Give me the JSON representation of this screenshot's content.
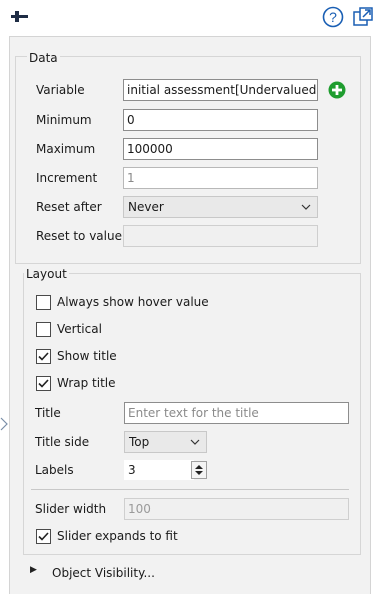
{
  "toolbar": {
    "tool_icon": "slider-tool-icon",
    "help_icon": "help-icon",
    "popout_icon": "popout-icon",
    "help_glyph": "?"
  },
  "data_section": {
    "title": "Data",
    "variable_label": "Variable",
    "variable_value": "initial assessment[Undervalued]",
    "minimum_label": "Minimum",
    "minimum_value": "0",
    "maximum_label": "Maximum",
    "maximum_value": "100000",
    "increment_label": "Increment",
    "increment_value": "1",
    "reset_after_label": "Reset after",
    "reset_after_value": "Never",
    "reset_to_value_label": "Reset to value",
    "reset_to_value_value": ""
  },
  "layout_section": {
    "title": "Layout",
    "always_show_hover_label": "Always show hover value",
    "always_show_hover_checked": false,
    "vertical_label": "Vertical",
    "vertical_checked": false,
    "show_title_label": "Show title",
    "show_title_checked": true,
    "wrap_title_label": "Wrap title",
    "wrap_title_checked": true,
    "title_label": "Title",
    "title_placeholder": "Enter text for the title",
    "title_side_label": "Title side",
    "title_side_value": "Top",
    "labels_label": "Labels",
    "labels_value": "3",
    "slider_width_label": "Slider width",
    "slider_width_value": "100",
    "slider_expands_label": "Slider expands to fit",
    "slider_expands_checked": true
  },
  "object_visibility": {
    "label": "Object Visibility...",
    "expander_glyph": "▶"
  },
  "colors": {
    "accent": "#1a5fb4",
    "add_green": "#1f9d2f",
    "panel_bg": "#f2f2f2"
  }
}
